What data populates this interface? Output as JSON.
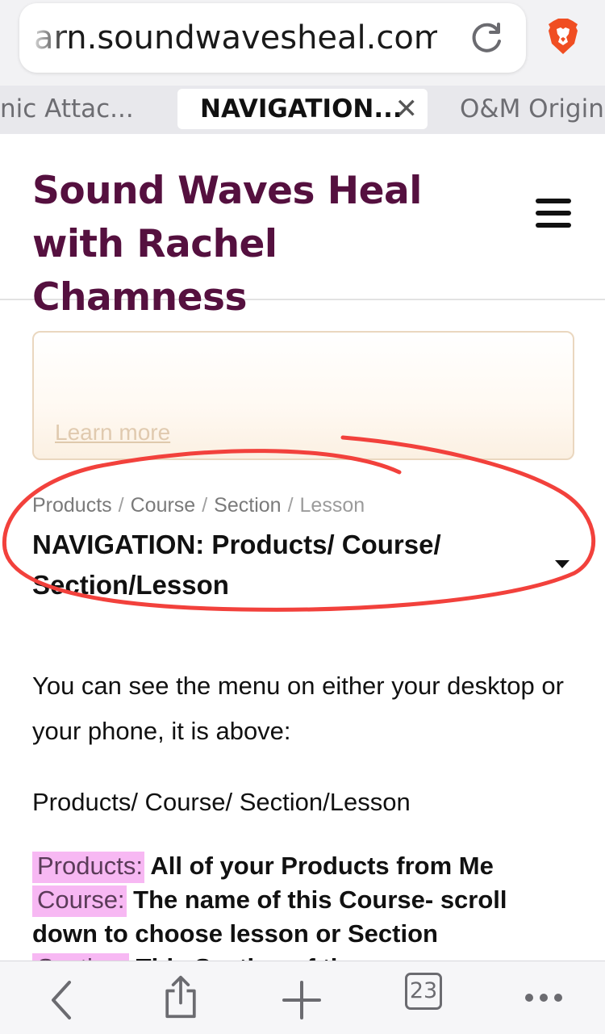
{
  "browser": {
    "url": "arn.soundwavesheal.com",
    "tabs": [
      {
        "label": "nic Attac..."
      },
      {
        "label": "NAVIGATION...",
        "close": "✕"
      },
      {
        "label": "O&M Origina"
      }
    ],
    "tab_count": "23"
  },
  "site": {
    "title": "Sound Waves Heal with Rachel Chamness"
  },
  "notice": {
    "link": "Learn more"
  },
  "breadcrumb": {
    "items": [
      "Products",
      "Course",
      "Section"
    ],
    "current": "Lesson",
    "separator": "/"
  },
  "lesson": {
    "title": "NAVIGATION: Products/ Course/ Section/Lesson"
  },
  "content": {
    "p1": "You can see the menu on either your desktop or your phone, it is above:",
    "p2": "Products/ Course/ Section/Lesson",
    "items": [
      {
        "label": "Products:",
        "text": " All of your Products from Me"
      },
      {
        "label": "Course:",
        "text": " The name of this Course- scroll down to choose lesson or Section"
      },
      {
        "label": "Section:",
        "text": " This Section of the course"
      }
    ]
  },
  "colors": {
    "title": "#55103f",
    "highlight": "#f7b8f3",
    "annotation": "#f2413c"
  }
}
